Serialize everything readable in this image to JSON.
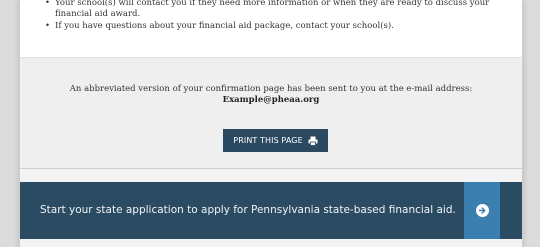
{
  "info": {
    "bullets": [
      "Your school(s) will contact you if they need more information or when they are ready to discuss your financial aid award.",
      "If you have questions about your financial aid package, contact your school(s)."
    ]
  },
  "confirmation": {
    "message": "An abbreviated version of your confirmation page has been sent to you at the e-mail address:",
    "email": "Example@pheaa.org",
    "print_label": "PRINT THIS PAGE",
    "print_icon": "printer-icon"
  },
  "cta": {
    "text": "Start your state application to apply for Pennsylvania state-based financial aid.",
    "icon": "arrow-right-circle-icon"
  },
  "colors": {
    "banner": "#2a4b62",
    "accent": "#3a7fb0",
    "button": "#2b4a62"
  }
}
